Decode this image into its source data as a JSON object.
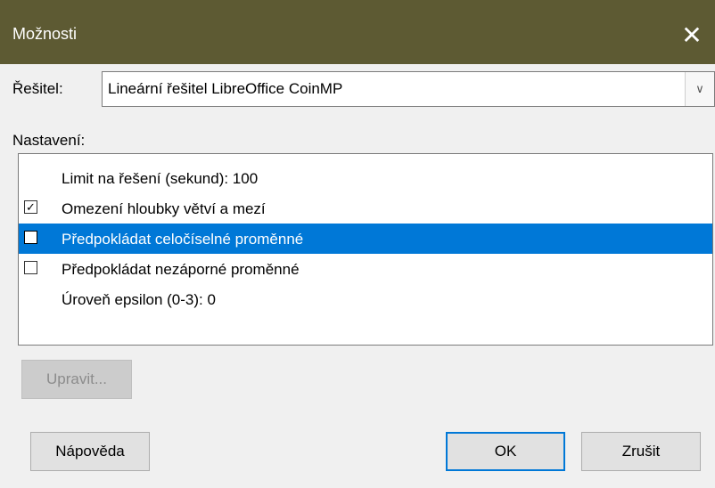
{
  "dialog": {
    "title": "Možnosti",
    "close_icon": "close-icon"
  },
  "solver": {
    "label": "Řešitel:",
    "selected": "Lineární řešitel LibreOffice CoinMP",
    "dropdown_icon": "chevron-down-icon"
  },
  "settings": {
    "label": "Nastavení:",
    "items": [
      {
        "label": "Limit na řešení (sekund): 100",
        "has_checkbox": false,
        "checked": false,
        "selected": false
      },
      {
        "label": "Omezení hloubky větví a mezí",
        "has_checkbox": true,
        "checked": true,
        "selected": false
      },
      {
        "label": "Předpokládat celočíselné proměnné",
        "has_checkbox": true,
        "checked": false,
        "selected": true
      },
      {
        "label": "Předpokládat nezáporné proměnné",
        "has_checkbox": true,
        "checked": false,
        "selected": false
      },
      {
        "label": "Úroveň epsilon (0-3): 0",
        "has_checkbox": false,
        "checked": false,
        "selected": false
      }
    ]
  },
  "buttons": {
    "edit": "Upravit...",
    "help": "Nápověda",
    "ok": "OK",
    "cancel": "Zrušit"
  },
  "colors": {
    "titlebar": "#5d5a33",
    "selection": "#0078d7"
  }
}
